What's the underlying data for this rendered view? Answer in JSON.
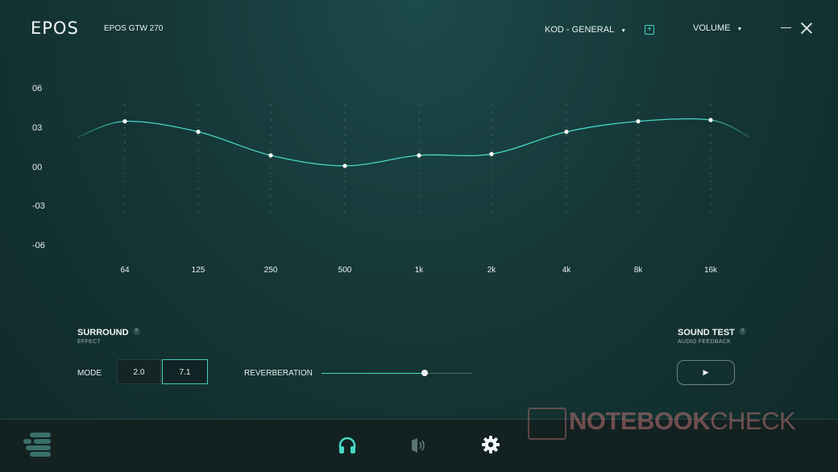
{
  "header": {
    "logo": "EPOS",
    "device": "EPOS GTW 270",
    "preset": "KOD - GENERAL",
    "volume_label": "VOLUME"
  },
  "chart_data": {
    "type": "line",
    "categories": [
      "64",
      "125",
      "250",
      "500",
      "1k",
      "2k",
      "4k",
      "8k",
      "16k"
    ],
    "values": [
      3.5,
      2.7,
      0.9,
      0.1,
      0.9,
      1.0,
      2.7,
      3.5,
      3.6
    ],
    "ylim": [
      -6,
      6
    ],
    "yticks": [
      "06",
      "03",
      "00",
      "-03",
      "-06"
    ],
    "title": "",
    "xlabel": "",
    "ylabel": "",
    "line_color": "#45d8c6"
  },
  "surround": {
    "title": "SURROUND",
    "subtitle": "EFFECT",
    "mode_label": "MODE",
    "modes": [
      "2.0",
      "7.1"
    ],
    "selected_mode": "7.1",
    "reverb_label": "REVERBERATION",
    "reverb_value": 0.69
  },
  "sound_test": {
    "title": "SOUND TEST",
    "subtitle": "AUDIO FEEDBACK"
  },
  "watermark": {
    "text_bold": "NOTEBOOK",
    "text_light": "CHECK"
  },
  "colors": {
    "accent": "#45d8c6",
    "background": "#163737",
    "bottom_bar": "#132121"
  }
}
